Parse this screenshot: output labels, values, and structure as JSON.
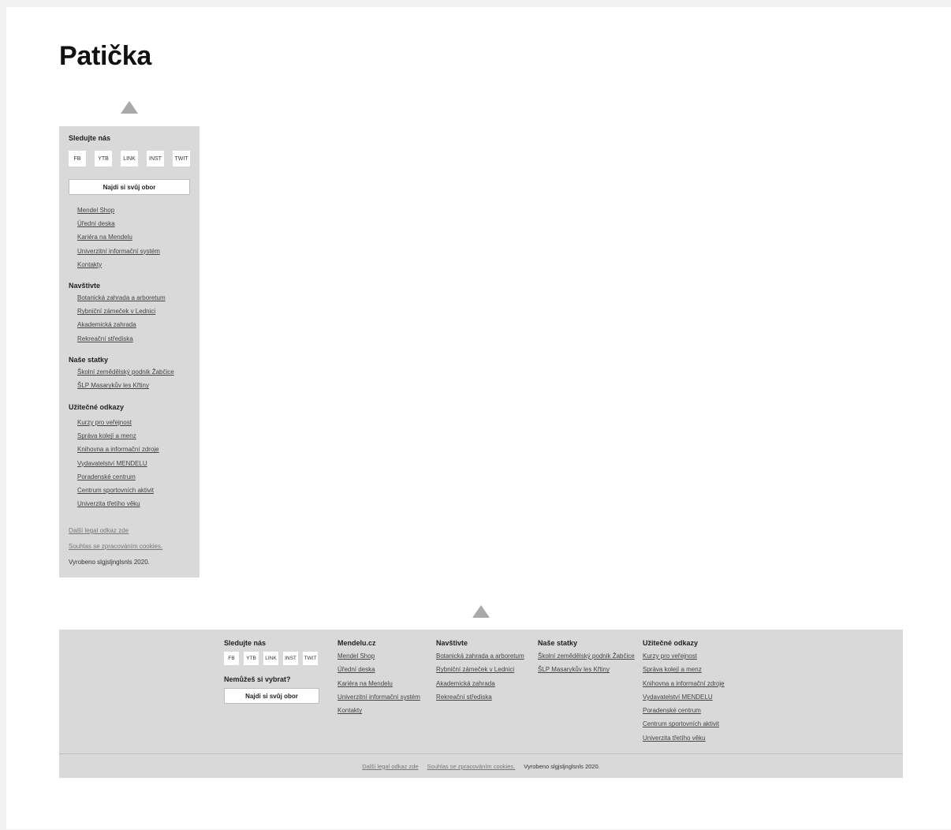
{
  "page": {
    "title": "Patička"
  },
  "social_buttons": [
    "FB",
    "YTB",
    "LINK",
    "INST",
    "TWIT"
  ],
  "mobile": {
    "follow_heading": "Sledujte nás",
    "cta": "Najdi si svůj obor",
    "mendelu_links": [
      "Mendel Shop",
      "Úřední deska",
      "Kariéra na Mendelu",
      "Univerzitní informační systém",
      "Kontakty"
    ],
    "visit_heading": "Navštivte",
    "visit_links": [
      "Botanická zahrada a arboretum",
      "Rybniční zámeček v Lednici",
      "Akademická zahrada",
      "Rekreační střediska"
    ],
    "estates_heading": "Naše statky",
    "estates_links": [
      "Školní zemědělský podnik Žabčice",
      "ŠLP Masarykův les Křtiny"
    ],
    "useful_heading": "Užitečné odkazy",
    "useful_links": [
      "Kurzy pro veřejnost",
      "Správa kolejí a menz",
      "Knihovna a informační zdroje",
      "Vydavatelství MENDELU",
      "Poradenské centrum",
      "Centrum sportovních aktivit",
      "Univerzita třetího věku"
    ],
    "legal_link": "Další legal odkaz zde",
    "cookies_link": "Souhlas se zpracováním cookies.",
    "made_by": "Vyrobeno slgjsljnglsnls 2020."
  },
  "desktop": {
    "follow_heading": "Sledujte nás",
    "question": "Nemůžeš si vybrat?",
    "cta": "Najdi si svůj obor",
    "mendelu_heading": "Mendelu.cz",
    "mendelu_links": [
      "Mendel Shop",
      "Úřední deska",
      "Kariéra na Mendelu",
      "Univerzitní informační systém",
      "Kontakty"
    ],
    "visit_heading": "Navštivte",
    "visit_links": [
      "Botanická zahrada a arboretum",
      "Rybniční zámeček v Lednici",
      "Akademická zahrada",
      "Rekreační střediska"
    ],
    "estates_heading": "Naše statky",
    "estates_links": [
      "Školní zemědělský podnik Žabčice",
      "ŠLP Masarykův les Křtiny"
    ],
    "useful_heading": "Užitečné odkazy",
    "useful_links": [
      "Kurzy pro veřejnost",
      "Správa kolejí a menz",
      "Knihovna a informační zdroje",
      "Vydavatelství MENDELU",
      "Poradenské centrum",
      "Centrum sportovních aktivit",
      "Univerzita třetího věku"
    ],
    "legal_link": "Další legal odkaz zde",
    "cookies_link": "Souhlas se zpracováním cookies.",
    "made_by": "Vyrobeno slgjsljnglsnls 2020."
  }
}
